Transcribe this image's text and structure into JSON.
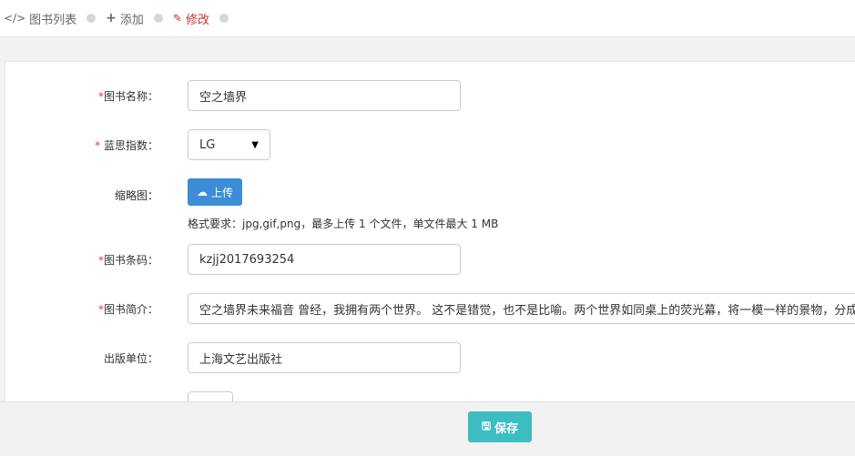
{
  "breadcrumb": {
    "list_label": "图书列表",
    "add_label": "添加",
    "edit_label": "修改"
  },
  "form": {
    "name": {
      "required_mark": "*",
      "label": "图书名称：",
      "value": "空之墙界"
    },
    "index": {
      "required_mark": "*",
      "label": " 蓝思指数：",
      "value": "LG"
    },
    "thumbnail": {
      "label": "缩略图：",
      "button_label": "上传",
      "hint": "格式要求：jpg,gif,png，最多上传 1 个文件，单文件最大 1 MB"
    },
    "barcode": {
      "required_mark": "*",
      "label": "图书条码：",
      "value": "kzjj2017693254"
    },
    "summary": {
      "required_mark": "*",
      "label": "图书简介：",
      "value": "空之墙界未来福音  曾经，我拥有两个世界。 这不是错觉，也不是比喻。两个世界如同桌上的荧光幕，将一模一样的景物，分成两"
    },
    "publisher": {
      "label": "出版单位：",
      "value": "上海文艺出版社"
    }
  },
  "footer": {
    "save_label": "保存"
  },
  "colors": {
    "accent_blue": "#3c8dd6",
    "save_teal": "#3dbdc2",
    "edit_red": "#c9302c",
    "required_red": "#e4393c"
  }
}
